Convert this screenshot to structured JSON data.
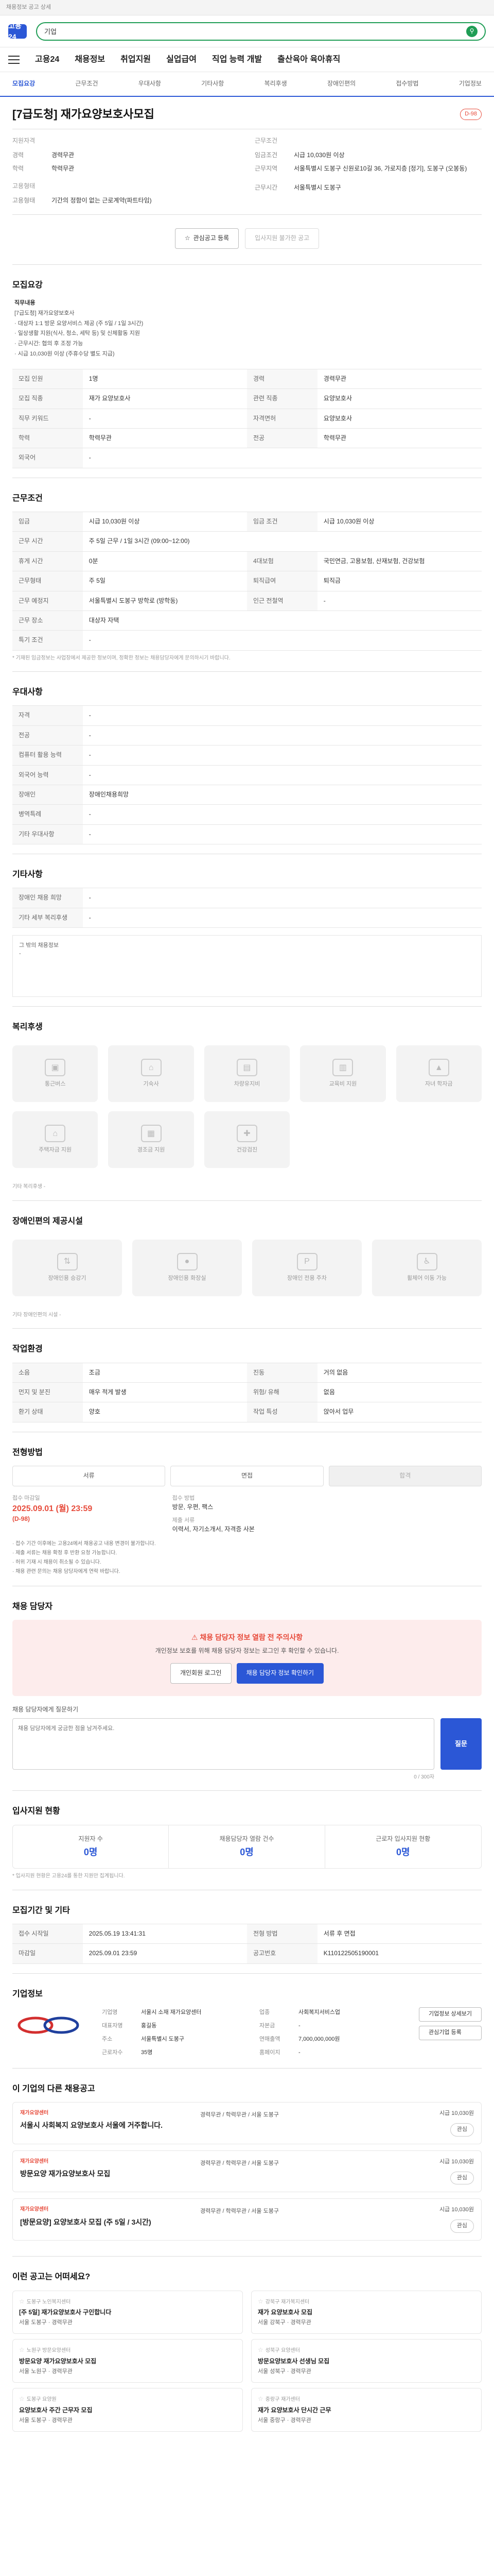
{
  "topbar": {
    "breadcrumb": "채용정보 공고 상세"
  },
  "header": {
    "logo": "고용24",
    "search_value": "기업",
    "search_placeholder": ""
  },
  "nav": {
    "items": [
      "고용24",
      "채용정보",
      "취업지원",
      "실업급여",
      "직업 능력 개발",
      "출산육아 육아휴직"
    ]
  },
  "section_nav": [
    "모집요강",
    "근무조건",
    "우대사항",
    "기타사항",
    "복리후생",
    "장애인편의",
    "접수방법",
    "기업정보"
  ],
  "job": {
    "title": "[7급도청] 재가요양보호사모집",
    "dday": "D-98",
    "summary_left_title": "지원자격",
    "career_label": "경력",
    "career": "경력무관",
    "edu_label": "학력",
    "edu": "학력무관",
    "cond_title": "근무조건",
    "emp_label": "고용형태",
    "emp": "기간의 정함이 없는 근로계약(파트타임)",
    "wage_label": "임금조건",
    "wage": "시급 10,030원 이상",
    "company_title": "고용형태",
    "loc_label": "근무지역",
    "loc": "서울특별시 도봉구",
    "time_label": "근무시간",
    "time": "시급 10,030원 이상",
    "etc_label": "지역",
    "etc": "서울특별시 도봉구 신원로10길 36, 가로지층 [정기], 도봉구 (오봉동)"
  },
  "cta": {
    "save": "관심공고 등록",
    "apply": "입사지원 불가한 공고"
  },
  "recruit": {
    "heading": "모집요강",
    "desc_title": "직무내용",
    "desc_lines": [
      "[7급도청] 재가요양보호사",
      "· 대상자 1:1 방문 요양서비스 제공 (주 5일 / 1일 3시간)",
      "· 일상생활 지원(식사, 청소, 세탁 등) 및 신체활동 지원",
      "· 근무시간: 협의 후 조정 가능",
      "· 시급 10,030원 이상 (주휴수당 별도 지급)"
    ],
    "rows": [
      [
        "모집 인원",
        "1명",
        "경력",
        "경력무관"
      ],
      [
        "모집 직종",
        "재가 요양보호사",
        "관련 직종",
        "요양보호사"
      ],
      [
        "직무 키워드",
        "-",
        "자격면허",
        "요양보호사"
      ],
      [
        "학력",
        "학력무관",
        "전공",
        "학력무관"
      ],
      [
        "외국어",
        "-",
        "",
        ""
      ]
    ]
  },
  "conditions": {
    "heading": "근무조건",
    "rows": [
      [
        "임금",
        "시급 10,030원 이상",
        "임금 조건",
        "시급 10,030원 이상"
      ],
      [
        "근무 시간",
        "주 5일 근무 / 1일 3시간 (09:00~12:00)",
        "",
        ""
      ],
      [
        "휴게 시간",
        "0분",
        "4대보험",
        "국민연금, 고용보험, 산재보험, 건강보험"
      ],
      [
        "근무형태",
        "주 5일",
        "퇴직급여",
        "퇴직금"
      ],
      [
        "근무 예정지",
        "서울특별시 도봉구 방학로 (방학동)",
        "인근 전철역",
        "-"
      ],
      [
        "근무 장소",
        "대상자 자택",
        "",
        ""
      ],
      [
        "특기 조건",
        "-",
        "",
        ""
      ]
    ],
    "note": "* 기재된 임금정보는 사업장에서 제공한 정보이며, 정확한 정보는 채용담당자에게 문의하시기 바랍니다."
  },
  "preferred": {
    "heading": "우대사항",
    "rows": [
      [
        "자격",
        "-"
      ],
      [
        "전공",
        "-"
      ],
      [
        "컴퓨터 활용 능력",
        "-"
      ],
      [
        "외국어 능력",
        "-"
      ],
      [
        "장애인",
        "장애인채용희망"
      ],
      [
        "병역특례",
        "-"
      ],
      [
        "기타 우대사항",
        "-"
      ]
    ]
  },
  "etc": {
    "heading": "기타사항",
    "rows": [
      [
        "장애인 채용 희망",
        "-"
      ],
      [
        "기타 세부 복리후생",
        "-"
      ]
    ],
    "box_label": "그 밖의 채용정보",
    "box_value": "-"
  },
  "welfare": {
    "heading": "복리후생",
    "items": [
      "통근버스",
      "기숙사",
      "차량유지비",
      "교육비 지원",
      "자녀 학자금",
      "주택자금 지원",
      "경조금 지원",
      "건강검진"
    ],
    "extra_label": "기타 복리후생",
    "extra_value": "-"
  },
  "disabled": {
    "heading": "장애인편의 제공시설",
    "items": [
      "장애인용 승강기",
      "장애인용 화장실",
      "장애인 전용 주차",
      "휠체어 이동 가능"
    ],
    "note_label": "기타 장애인편의 시설",
    "note_value": "-"
  },
  "workplace": {
    "heading": "작업환경",
    "rows": [
      [
        "소음",
        "조금",
        "진동",
        "거의 없음"
      ],
      [
        "먼지 및 분진",
        "매우 적게 발생",
        "위험/ 유해",
        "없음"
      ],
      [
        "환기 상태",
        "양호",
        "작업 특성",
        "앉아서 업무"
      ]
    ]
  },
  "apply": {
    "heading": "전형방법",
    "steps": [
      "서류",
      "면접",
      "합격"
    ],
    "deadline_label": "접수 마감일",
    "deadline": "2025.09.01 (월) 23:59",
    "deadline_sub": "(D-98)",
    "method_label": "접수 방법",
    "method": "방문, 우편, 팩스",
    "docs_label": "제출 서류",
    "docs": "이력서, 자기소개서, 자격증 사본",
    "bullets": [
      "· 접수 기간 이후에는 고용24에서 채용공고 내용 변경이 불가합니다.",
      "· 제출 서류는 채용 확정 후 반환 요청 가능합니다.",
      "· 허위 기재 시 채용이 취소될 수 있습니다.",
      "· 채용 관련 문의는 채용 담당자에게 연락 바랍니다."
    ]
  },
  "contact": {
    "heading": "채용 담당자",
    "alert_head": "채용 담당자 정보 열람 전 주의사항",
    "alert_text": "개인정보 보호를 위해 채용 담당자 정보는 로그인 후 확인할 수 있습니다.",
    "login_btn": "개인회원 로그인",
    "view_btn": "채용 담당자 정보 확인하기",
    "q_label": "채용 담당자에게 질문하기",
    "q_placeholder": "채용 담당자에게 궁금한 점을 남겨주세요.",
    "q_count": "0 / 300자",
    "q_btn": "질문"
  },
  "stats": {
    "heading": "입사지원 현황",
    "items": [
      {
        "label": "지원자 수",
        "value": "0명"
      },
      {
        "label": "채용담당자 열람 건수",
        "value": "0명"
      },
      {
        "label": "근로자 입사지원 현황",
        "value": "0명"
      }
    ],
    "note": "* 입사지원 현황은 고용24를 통한 지원만 집계됩니다."
  },
  "period": {
    "heading": "모집기간 및 기타",
    "rows": [
      [
        "접수 시작일",
        "2025.05.19 13:41:31",
        "전형 방법",
        "서류 후 면접"
      ],
      [
        "마감일",
        "2025.09.01 23:59",
        "공고번호",
        "K110122505190001"
      ]
    ]
  },
  "company": {
    "heading": "기업정보",
    "name": "기업명 재가요양센터",
    "rows": [
      [
        "기업명",
        "서울시 소재 재가요양센터",
        "업종",
        "사회복지서비스업"
      ],
      [
        "대표자명",
        "홍길동",
        "자본금",
        "-"
      ],
      [
        "주소",
        "서울특별시 도봉구",
        "연매출액",
        "7,000,000,000원"
      ],
      [
        "근로자수",
        "35명",
        "홈페이지",
        "-"
      ]
    ],
    "btn1": "기업정보 상세보기",
    "btn2": "관심기업 등록"
  },
  "similar": {
    "heading": "이 기업의 다른 채용공고",
    "items": [
      {
        "company": "재가요양센터",
        "title": "서울시 사회복지 요양보호사 서울에 거주합니다.",
        "info": "경력무관 / 학력무관 / 서울 도봉구",
        "wage": "시급 10,030원",
        "btn": "관심"
      },
      {
        "company": "재가요양센터",
        "title": "방문요양 재가요양보호사 모집",
        "info": "경력무관 / 학력무관 / 서울 도봉구",
        "wage": "시급 10,030원",
        "btn": "관심"
      },
      {
        "company": "재가요양센터",
        "title": "[방문요양] 요양보호사 모집 (주 5일 / 3시간)",
        "info": "경력무관 / 학력무관 / 서울 도봉구",
        "wage": "시급 10,030원",
        "btn": "관심"
      }
    ]
  },
  "recommend": {
    "heading": "이런 공고는 어떠세요?",
    "items": [
      {
        "company": "도봉구 노인복지센터",
        "title": "[주 5일] 재가요양보호사 구인합니다",
        "meta": "서울 도봉구 · 경력무관"
      },
      {
        "company": "강북구 재가복지센터",
        "title": "재가 요양보호사 모집",
        "meta": "서울 강북구 · 경력무관"
      },
      {
        "company": "노원구 방문요양센터",
        "title": "방문요양 재가요양보호사 모집",
        "meta": "서울 노원구 · 경력무관"
      },
      {
        "company": "성북구 요양센터",
        "title": "방문요양보호사 선생님 모집",
        "meta": "서울 성북구 · 경력무관"
      },
      {
        "company": "도봉구 요양원",
        "title": "요양보호사 주간 근무자 모집",
        "meta": "서울 도봉구 · 경력무관"
      },
      {
        "company": "중랑구 재가센터",
        "title": "재가 요양보호사 단시간 근무",
        "meta": "서울 중랑구 · 경력무관"
      }
    ]
  },
  "colors": {
    "accent": "#2b57d6",
    "alert": "#e74c3c",
    "green": "#1f9d55"
  }
}
